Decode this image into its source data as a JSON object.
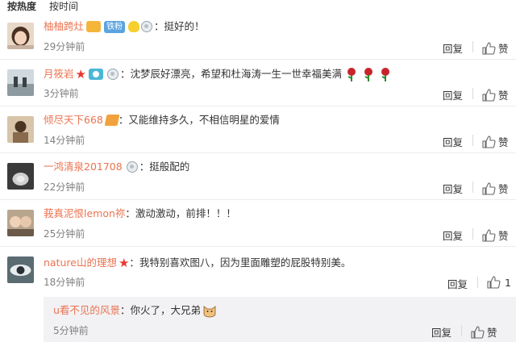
{
  "tabs": {
    "hot": "按热度",
    "time": "按时间"
  },
  "actions": {
    "reply": "回复"
  },
  "comments": [
    {
      "user": "柚柚跨灶",
      "text": "：挺好的！",
      "time": "29分钟前"
    },
    {
      "user": "月筱岩",
      "text": "：沈梦辰好漂亮，希望和杜海涛一生一世幸福美满",
      "time": "3分钟前"
    },
    {
      "user": "倾尽天下668",
      "text": "：又能维持多久，不相信明星的爱情",
      "time": "14分钟前"
    },
    {
      "user": "一鸿清泉201708",
      "text": "：挺般配的",
      "time": "22分钟前"
    },
    {
      "user": "莪真泥恨lemon祢",
      "text": "：激动激动，前排！！！",
      "time": "25分钟前"
    },
    {
      "user": "nature山的理想",
      "text": "：我特别喜欢图八，因为里面雕塑的屁股特别美。",
      "time": "18分钟前",
      "likes": "1"
    }
  ],
  "subreply": {
    "user": "u看不见的风景",
    "text": "：你火了，大兄弟",
    "time": "5分钟前"
  },
  "badges": {
    "tiefen": "铁粉"
  },
  "colors": {
    "username": "#eb7350",
    "text": "#333333",
    "time": "#808080",
    "badge_blue": "#5aa3e0"
  }
}
